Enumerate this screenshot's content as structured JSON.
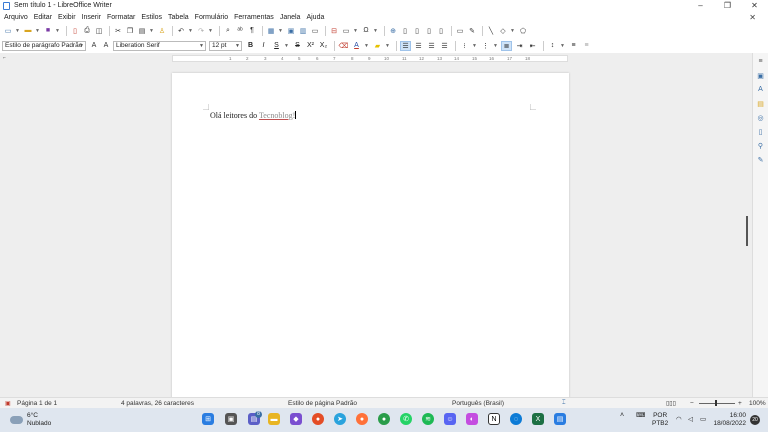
{
  "window": {
    "title": "Sem título 1 - LibreOffice Writer",
    "controls": {
      "minimize": "–",
      "maximize": "❐",
      "close": "✕"
    }
  },
  "menu": {
    "items": [
      "Arquivo",
      "Editar",
      "Exibir",
      "Inserir",
      "Formatar",
      "Estilos",
      "Tabela",
      "Formulário",
      "Ferramentas",
      "Janela",
      "Ajuda"
    ],
    "close_doc": "✕"
  },
  "formatting": {
    "paragraph_style": "Estilo de parágrafo Padrão",
    "font_name": "Liberation Serif",
    "font_size": "12 pt",
    "bold": "B",
    "italic": "I",
    "underline": "S",
    "strike": "S",
    "superscript": "X²",
    "subscript": "X₂",
    "font_color": "A"
  },
  "ruler": {
    "ticks": [
      "1",
      "2",
      "3",
      "4",
      "5",
      "6",
      "7",
      "8",
      "9",
      "10",
      "11",
      "12",
      "13",
      "14",
      "15",
      "16",
      "17",
      "18"
    ]
  },
  "document": {
    "text_before": "Olá leitores do ",
    "link_text": "Tecnoblog",
    "text_after": "!"
  },
  "status": {
    "page": "Página 1 de 1",
    "words": "4 palavras, 26 caracteres",
    "page_style": "Estilo de página Padrão",
    "language": "Português (Brasil)",
    "zoom": "100%"
  },
  "taskbar": {
    "weather_temp": "6°C",
    "weather_desc": "Nublado",
    "lang_top": "POR",
    "lang_bottom": "PTB2",
    "time": "16:00",
    "date": "18/08/2022",
    "notification_count": "20",
    "chat_badge": "8"
  },
  "colors": {
    "accent": "#3a6ea5",
    "taskbar": "#dfe6ef",
    "workspace": "#eeeeee"
  }
}
